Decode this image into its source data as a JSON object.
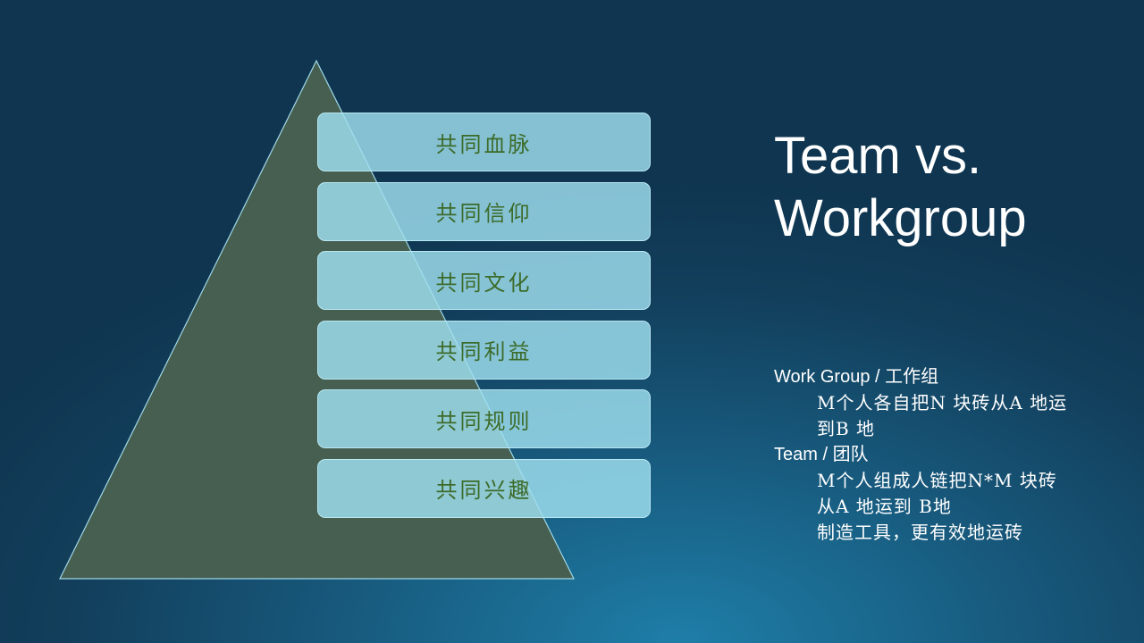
{
  "pyramid": {
    "levels": [
      {
        "label": "共同血脉"
      },
      {
        "label": "共同信仰"
      },
      {
        "label": "共同文化"
      },
      {
        "label": "共同利益"
      },
      {
        "label": "共同规则"
      },
      {
        "label": "共同兴趣"
      }
    ]
  },
  "title": {
    "line1": "Team vs.",
    "line2": "Workgroup"
  },
  "notes": {
    "workgroup_heading": "Work Group / 工作组",
    "workgroup_line1": "M个人各自把N 块砖从A 地运",
    "workgroup_line2": "到B 地",
    "team_heading": "Team / 团队",
    "team_line1": "M个人组成人链把N*M 块砖",
    "team_line2": "从A 地运到 B地",
    "team_line3": "制造工具，更有效地运砖"
  },
  "colors": {
    "triangle_fill": "#465f50",
    "bar_fill": "#a0e1f0",
    "bar_text": "#3d6b2a",
    "text": "#ffffff"
  }
}
